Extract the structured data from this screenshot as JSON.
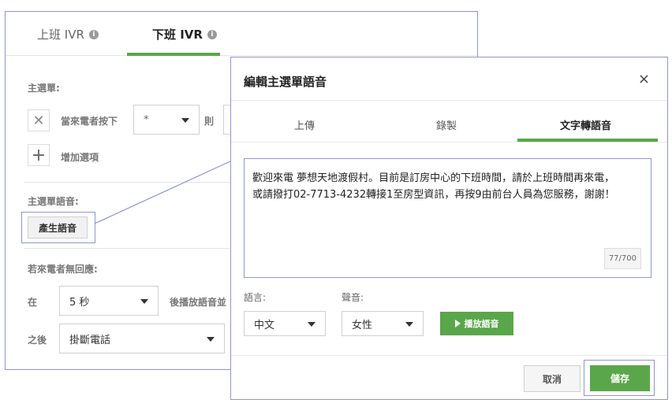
{
  "bg": {
    "tabs": [
      {
        "label": "上班 IVR"
      },
      {
        "label": "下班 IVR"
      }
    ],
    "main_menu_label": "主選單:",
    "when_caller_presses": "當來電者按下",
    "key_value": "*",
    "then_label": "則",
    "add_option": "增加選項",
    "menu_voice_label": "主選單語音:",
    "generate_voice": "產生語音",
    "no_response_label": "若來電者無回應:",
    "at_label": "在",
    "seconds_value": "5 秒",
    "after_play_text": "後播放語音並",
    "after_label": "之後",
    "after_action_value": "掛斷電話"
  },
  "modal": {
    "title": "編輯主選單語音",
    "close": "×",
    "tabs": [
      {
        "label": "上傳"
      },
      {
        "label": "錄製"
      },
      {
        "label": "文字轉語音"
      }
    ],
    "text_line1": "歡迎來電 夢想天地渡假村。目前是訂房中心的下班時間，請於上班時間再來電，",
    "text_line2": "或請撥打02-7713-4232轉接1至房型資訊，再按9由前台人員為您服務，謝謝！",
    "char_count": "77/700",
    "language_label": "語言:",
    "language_value": "中文",
    "voice_label": "聲音:",
    "voice_value": "女性",
    "play_label": "播放語音",
    "cancel_label": "取消",
    "save_label": "儲存"
  },
  "colors": {
    "accent": "#5aa64a",
    "highlight": "#8f97c9"
  }
}
